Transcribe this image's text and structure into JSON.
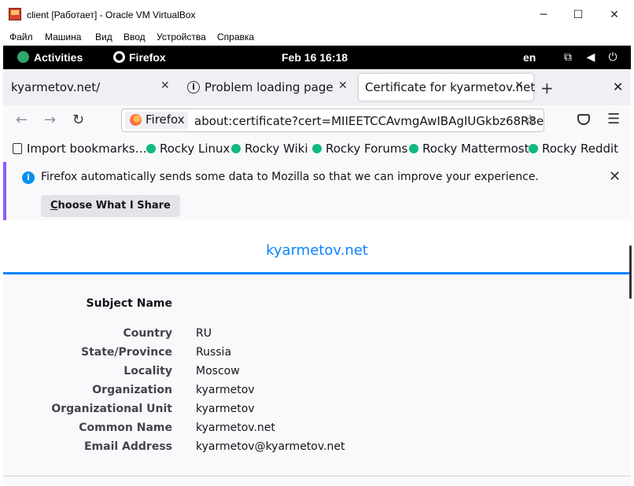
{
  "window": {
    "title": "client [Работает] - Oracle VM VirtualBox",
    "minimize": "─",
    "maximize": "☐",
    "close": "✕"
  },
  "vb_menu": [
    "Файл",
    "Машина",
    "Вид",
    "Ввод",
    "Устройства",
    "Справка"
  ],
  "gnome": {
    "activities": "Activities",
    "app": "Firefox",
    "clock": "Feb 16  16:18",
    "lang": "en"
  },
  "tabs": [
    {
      "label": "kyarmetov.net/"
    },
    {
      "label": "Problem loading page"
    },
    {
      "label": "Certificate for kyarmetov.net"
    }
  ],
  "nav": {
    "identity": "Firefox",
    "url": "about:certificate?cert=MIIEETCCAvmgAwIBAgIUGkbz68R8e"
  },
  "bookmarks": [
    "Import bookmarks…",
    "Rocky Linux",
    "Rocky Wiki",
    "Rocky Forums",
    "Rocky Mattermost",
    "Rocky Reddit"
  ],
  "notice": {
    "message": "Firefox automatically sends some data to Mozilla so that we can improve your experience.",
    "button_first": "C",
    "button_rest": "hoose What I Share"
  },
  "certificate": {
    "title": "kyarmetov.net",
    "section": "Subject Name",
    "rows": [
      {
        "label": "Country",
        "value": "RU"
      },
      {
        "label": "State/Province",
        "value": "Russia"
      },
      {
        "label": "Locality",
        "value": "Moscow"
      },
      {
        "label": "Organization",
        "value": "kyarmetov"
      },
      {
        "label": "Organizational Unit",
        "value": "kyarmetov"
      },
      {
        "label": "Common Name",
        "value": "kyarmetov.net"
      },
      {
        "label": "Email Address",
        "value": "kyarmetov@kyarmetov.net"
      }
    ]
  },
  "colors": {
    "accent": "#0a84ff",
    "notice_bar": "#9059ff",
    "info": "#0090ed"
  }
}
